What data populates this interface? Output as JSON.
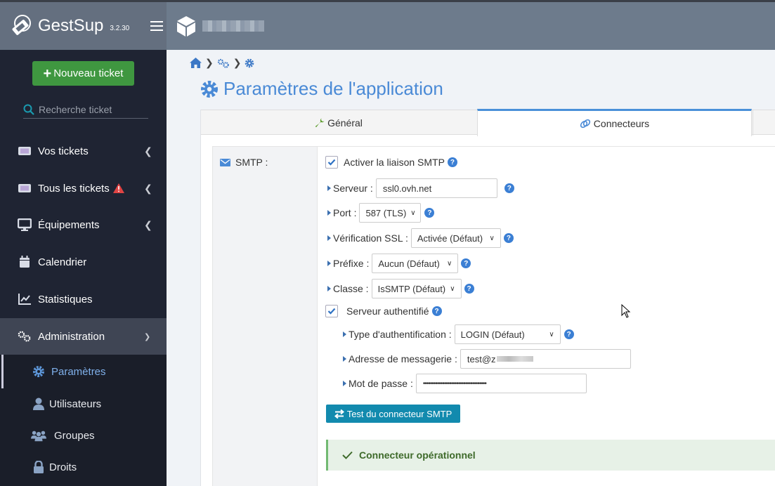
{
  "app": {
    "brand": "GestSup",
    "version": "3.2.30",
    "company_name": "[blurred]"
  },
  "sidebar": {
    "new_ticket_label": "Nouveau ticket",
    "search_placeholder": "Recherche ticket",
    "items": [
      {
        "label": "Vos tickets",
        "icon": "ticket-icon",
        "chevron": "left"
      },
      {
        "label": "Tous les tickets",
        "icon": "ticket-icon",
        "badge": "warning-icon",
        "chevron": "left"
      },
      {
        "label": "Équipements",
        "icon": "desktop-icon",
        "chevron": "left"
      },
      {
        "label": "Calendrier",
        "icon": "calendar-icon"
      },
      {
        "label": "Statistiques",
        "icon": "chart-line-icon"
      },
      {
        "label": "Administration",
        "icon": "cogs-icon",
        "chevron": "down",
        "active": true
      }
    ],
    "submenu": [
      {
        "label": "Paramètres",
        "icon": "gear-icon",
        "active": true
      },
      {
        "label": "Utilisateurs",
        "icon": "user-icon"
      },
      {
        "label": "Groupes",
        "icon": "users-icon"
      },
      {
        "label": "Droits",
        "icon": "lock-icon"
      }
    ]
  },
  "breadcrumb": [
    "home-icon",
    "cogs-icon",
    "gear-icon"
  ],
  "page": {
    "title": "Paramètres de l'application"
  },
  "tabs": [
    {
      "label": "Général",
      "icon": "wrench-icon",
      "active": false
    },
    {
      "label": "Connecteurs",
      "icon": "link-icon",
      "active": true
    }
  ],
  "smtp": {
    "section_label": "SMTP :",
    "enable_label": "Activer la liaison SMTP",
    "enable_checked": true,
    "server_label": "Serveur :",
    "server_value": "ssl0.ovh.net",
    "port_label": "Port :",
    "port_value": "587 (TLS)",
    "ssl_label": "Vérification SSL :",
    "ssl_value": "Activée (Défaut)",
    "prefix_label": "Préfixe :",
    "prefix_value": "Aucun (Défaut)",
    "class_label": "Classe :",
    "class_value": "IsSMTP (Défaut)",
    "auth_label": "Serveur authentifié",
    "auth_checked": true,
    "auth_type_label": "Type d'authentification :",
    "auth_type_value": "LOGIN (Défaut)",
    "email_label": "Adresse de messagerie :",
    "email_value": "test@z",
    "password_label": "Mot de passe :",
    "password_value": "••••••••••••••••••••••••••••••••••••",
    "test_button_label": "Test du connecteur SMTP",
    "status_message": "Connecteur opérationnel"
  },
  "colors": {
    "accent": "#4a8ad6",
    "success": "#3f9740",
    "info_button": "#128aae",
    "alert_bg": "#e7f1e7"
  }
}
